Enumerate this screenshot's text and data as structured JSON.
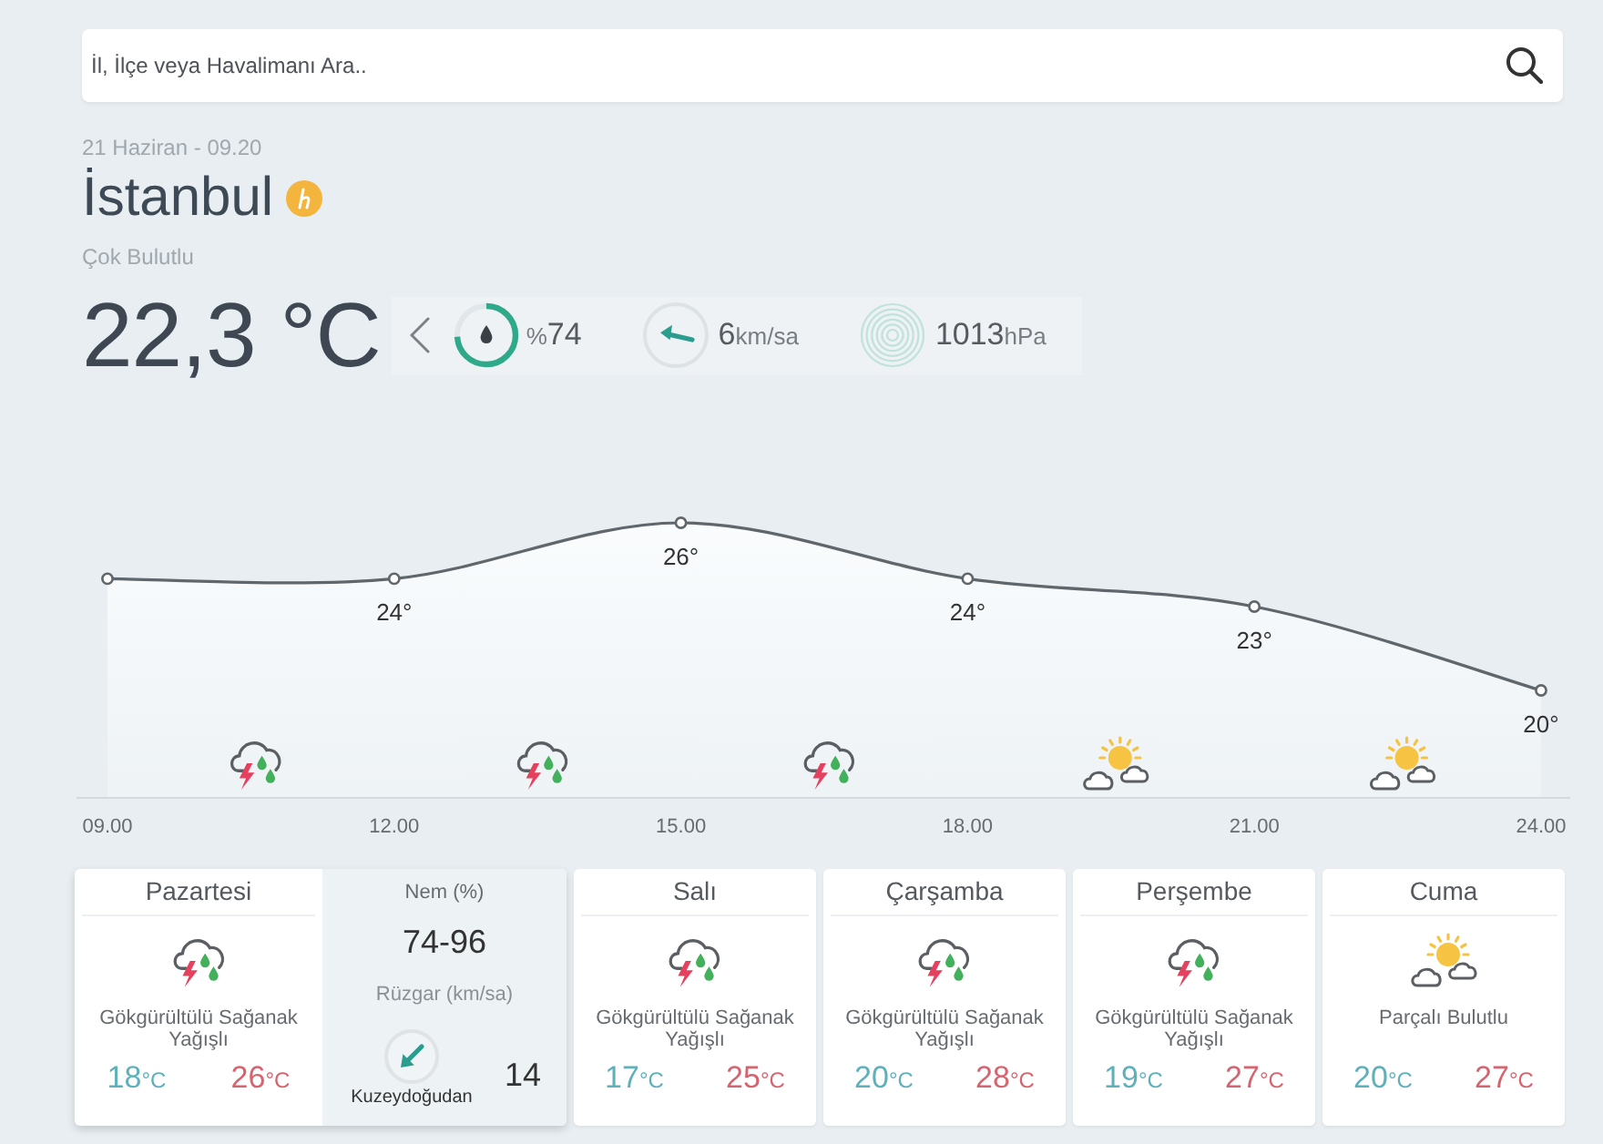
{
  "search": {
    "placeholder": "İl, İlçe veya Havalimanı Ara.."
  },
  "current": {
    "date": "21 Haziran - 09.20",
    "city": "İstanbul",
    "condition": "Çok Bulutlu",
    "temperature": "22,3 °C",
    "humidity": {
      "unit": "%",
      "value": "74",
      "level": 0.74
    },
    "wind": {
      "value": "6",
      "unit": "km/sa"
    },
    "pressure": {
      "value": "1013",
      "unit": "hPa"
    }
  },
  "hourly": {
    "chart_data": {
      "type": "area",
      "categories": [
        "09.00",
        "12.00",
        "15.00",
        "18.00",
        "21.00",
        "24.00"
      ],
      "series": [
        {
          "color": "#5f666c",
          "marker": "circle",
          "values": [
            24,
            24,
            26,
            24,
            23,
            20
          ],
          "value_labels": [
            null,
            "24°",
            "26°",
            "24°",
            "23°",
            "20°"
          ]
        }
      ],
      "data_labels": true
    },
    "periods": [
      {
        "kind": "storm"
      },
      {
        "kind": "storm"
      },
      {
        "kind": "storm"
      },
      {
        "kind": "partly_cloudy"
      },
      {
        "kind": "partly_cloudy"
      }
    ]
  },
  "days": [
    {
      "name": "Pazartesi",
      "kind": "storm",
      "condition": "Gökgürültülü Sağanak Yağışlı",
      "low": {
        "value": "18",
        "unit": "°C"
      },
      "high": {
        "value": "26",
        "unit": "°C"
      },
      "selected": true,
      "details": {
        "humidity_label": "Nem (%)",
        "humidity": "74-96",
        "wind_label": "Rüzgar (km/sa)",
        "wind_direction": "Kuzeydoğudan",
        "wind_speed": "14"
      }
    },
    {
      "name": "Salı",
      "kind": "storm",
      "condition": "Gökgürültülü Sağanak Yağışlı",
      "low": {
        "value": "17",
        "unit": "°C"
      },
      "high": {
        "value": "25",
        "unit": "°C"
      },
      "selected": false
    },
    {
      "name": "Çarşamba",
      "kind": "storm",
      "condition": "Gökgürültülü Sağanak Yağışlı",
      "low": {
        "value": "20",
        "unit": "°C"
      },
      "high": {
        "value": "28",
        "unit": "°C"
      },
      "selected": false
    },
    {
      "name": "Perşembe",
      "kind": "storm",
      "condition": "Gökgürültülü Sağanak Yağışlı",
      "low": {
        "value": "19",
        "unit": "°C"
      },
      "high": {
        "value": "27",
        "unit": "°C"
      },
      "selected": false
    },
    {
      "name": "Cuma",
      "kind": "partly_cloudy",
      "condition": "Parçalı Bulutlu",
      "low": {
        "value": "20",
        "unit": "°C"
      },
      "high": {
        "value": "27",
        "unit": "°C"
      },
      "selected": false
    }
  ]
}
